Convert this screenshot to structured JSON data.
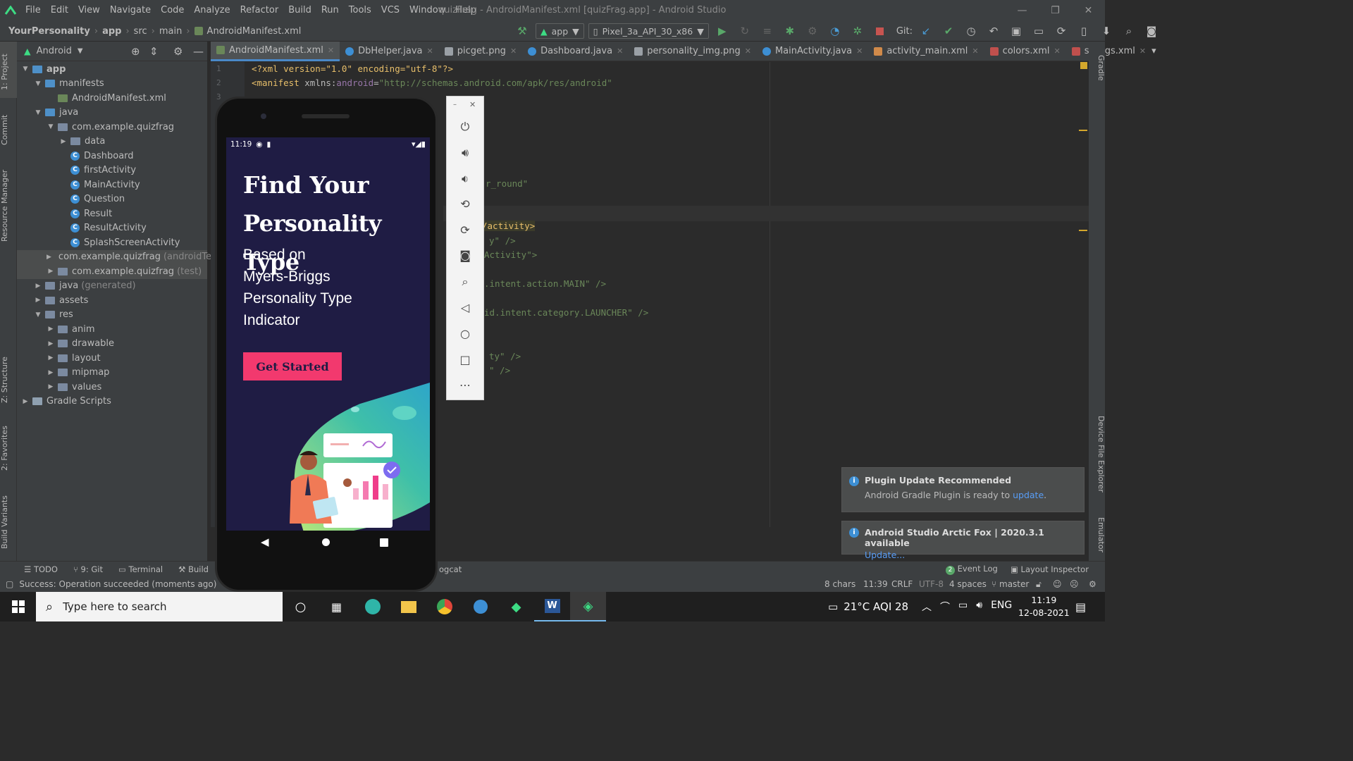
{
  "window": {
    "title": "quizFrag - AndroidManifest.xml [quizFrag.app] - Android Studio",
    "menu": [
      "File",
      "Edit",
      "View",
      "Navigate",
      "Code",
      "Analyze",
      "Refactor",
      "Build",
      "Run",
      "Tools",
      "VCS",
      "Window",
      "Help"
    ],
    "controls": {
      "minimize": "—",
      "maximize": "❐",
      "close": "✕"
    }
  },
  "breadcrumb": [
    "YourPersonality",
    "app",
    "src",
    "main",
    "AndroidManifest.xml"
  ],
  "toolbar": {
    "run_config": "app",
    "device": "Pixel_3a_API_30_x86",
    "git_label": "Git:"
  },
  "project_panel": {
    "view": "Android",
    "tree": [
      {
        "label": "app",
        "depth": 0,
        "kind": "module",
        "expanded": true
      },
      {
        "label": "manifests",
        "depth": 1,
        "kind": "folderb",
        "expanded": true
      },
      {
        "label": "AndroidManifest.xml",
        "depth": 2,
        "kind": "xml"
      },
      {
        "label": "java",
        "depth": 1,
        "kind": "folderb",
        "expanded": true
      },
      {
        "label": "com.example.quizfrag",
        "depth": 2,
        "kind": "pkg",
        "expanded": true
      },
      {
        "label": "data",
        "depth": 3,
        "kind": "pkg",
        "collapsed": true
      },
      {
        "label": "Dashboard",
        "depth": 3,
        "kind": "class"
      },
      {
        "label": "firstActivity",
        "depth": 3,
        "kind": "class"
      },
      {
        "label": "MainActivity",
        "depth": 3,
        "kind": "class"
      },
      {
        "label": "Question",
        "depth": 3,
        "kind": "class"
      },
      {
        "label": "Result",
        "depth": 3,
        "kind": "class"
      },
      {
        "label": "ResultActivity",
        "depth": 3,
        "kind": "class"
      },
      {
        "label": "SplashScreenActivity",
        "depth": 3,
        "kind": "class"
      },
      {
        "label": "com.example.quizfrag",
        "suffix": "(androidTest)",
        "depth": 2,
        "kind": "pkg",
        "collapsed": true,
        "selected": true
      },
      {
        "label": "com.example.quizfrag",
        "suffix": "(test)",
        "depth": 2,
        "kind": "pkg",
        "collapsed": true,
        "selected": true
      },
      {
        "label": "java",
        "suffix": "(generated)",
        "depth": 1,
        "kind": "folder",
        "collapsed": true
      },
      {
        "label": "assets",
        "depth": 1,
        "kind": "folder",
        "collapsed": true
      },
      {
        "label": "res",
        "depth": 1,
        "kind": "folder",
        "expanded": true
      },
      {
        "label": "anim",
        "depth": 2,
        "kind": "folder",
        "collapsed": true
      },
      {
        "label": "drawable",
        "depth": 2,
        "kind": "folder",
        "collapsed": true
      },
      {
        "label": "layout",
        "depth": 2,
        "kind": "folder",
        "collapsed": true
      },
      {
        "label": "mipmap",
        "depth": 2,
        "kind": "folder",
        "collapsed": true
      },
      {
        "label": "values",
        "depth": 2,
        "kind": "folder",
        "collapsed": true
      },
      {
        "label": "Gradle Scripts",
        "depth": 0,
        "kind": "gradle",
        "collapsed": true
      }
    ]
  },
  "left_tool_tabs": [
    "1: Project",
    "Commit",
    "Resource Manager",
    "Z: Structure",
    "2: Favorites",
    "Build Variants"
  ],
  "right_tool_tabs": [
    "Gradle",
    "Device File Explorer",
    "Emulator"
  ],
  "editor_tabs": [
    {
      "label": "AndroidManifest.xml",
      "active": true,
      "icon": "xml"
    },
    {
      "label": "DbHelper.java",
      "icon": "class"
    },
    {
      "label": "picget.png",
      "icon": "image"
    },
    {
      "label": "Dashboard.java",
      "icon": "class"
    },
    {
      "label": "personality_img.png",
      "icon": "image"
    },
    {
      "label": "MainActivity.java",
      "icon": "class"
    },
    {
      "label": "activity_main.xml",
      "icon": "layout"
    },
    {
      "label": "colors.xml",
      "icon": "values"
    },
    {
      "label": "strings.xml",
      "icon": "values"
    }
  ],
  "code": {
    "line1": "<?xml version=\"1.0\" encoding=\"utf-8\"?>",
    "line2_tag": "<manifest ",
    "line2_ns": "xmlns:",
    "line2_attr": "android",
    "line2_eq": "=",
    "line2_str": "\"http://schemas.android.com/apk/res/android\"",
    "frag_round": "r_round\"",
    "frag_activity_close": "/activity>",
    "frag_y": "y\" />",
    "frag_activity": "Activity\">",
    "frag_main": ".intent.action.MAIN\" />",
    "frag_launcher": "id.intent.category.LAUNCHER\" />",
    "frag_ty": "ty\" />",
    "frag_q": "\" />"
  },
  "bottom_tools": [
    "TODO",
    "9: Git",
    "Terminal",
    "Build",
    "ogcat"
  ],
  "bottom_right_tools": [
    "Event Log",
    "Layout Inspector"
  ],
  "event_log_count": "2",
  "status": {
    "message": "Success: Operation succeeded (moments ago)",
    "chars": "8 chars",
    "position": "11:39",
    "line_sep": "CRLF",
    "encoding": "UTF-8",
    "indent": "4 spaces",
    "branch": "master"
  },
  "notifications": [
    {
      "title": "Plugin Update Recommended",
      "body": "Android Gradle Plugin is ready to ",
      "link": "update",
      "after": "."
    },
    {
      "title": "Android Studio Arctic Fox | 2020.3.1 available",
      "link": "Update..."
    }
  ],
  "phone": {
    "time": "11:19",
    "heading_line1": "Find Your",
    "heading_line2": "Personality Type",
    "sub_line1": "Based on",
    "sub_line2": "Myers-Briggs",
    "sub_line3": "Personality Type",
    "sub_line4": "Indicator",
    "cta": "Get Started",
    "colors": {
      "background": "#1f1c44",
      "accent": "#f2396e"
    }
  },
  "emulator_controls": [
    "power",
    "volume-up",
    "volume-down",
    "rotate-left",
    "rotate-right",
    "screenshot",
    "zoom",
    "back",
    "home",
    "overview",
    "more"
  ],
  "taskbar": {
    "search_placeholder": "Type here to search",
    "weather": "21°C  AQI 28",
    "lang": "ENG",
    "time": "11:19",
    "date": "12-08-2021"
  }
}
